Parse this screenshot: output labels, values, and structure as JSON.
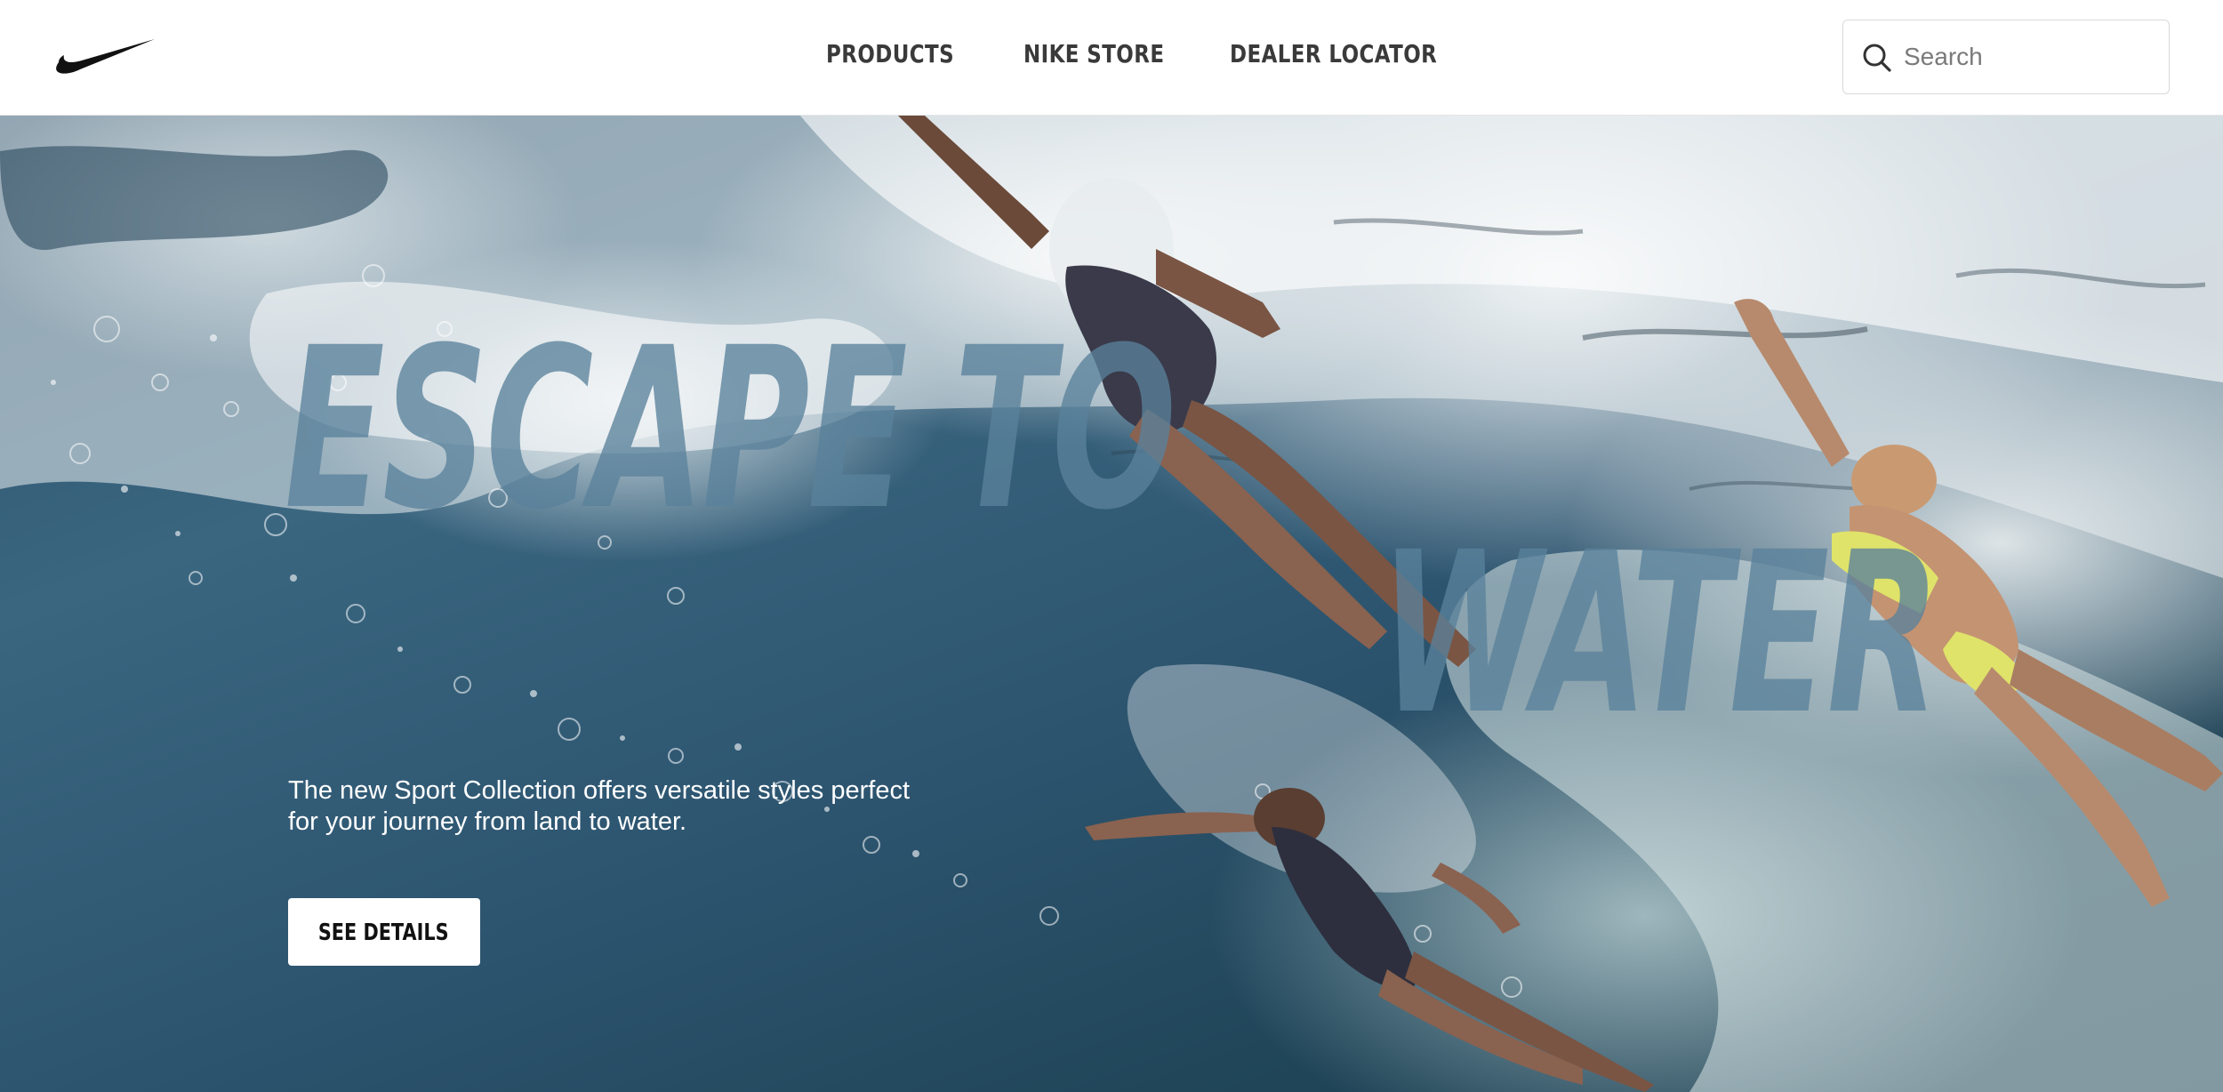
{
  "brand": {
    "logo": "swoosh-logo",
    "logo_color": "#111111"
  },
  "nav": {
    "items": [
      {
        "label": "PRODUCTS"
      },
      {
        "label": "NIKE STORE"
      },
      {
        "label": "DEALER LOCATOR"
      }
    ]
  },
  "search": {
    "placeholder": "Search",
    "icon": "search-icon"
  },
  "hero": {
    "headline_line1": "ESCAPE TO",
    "headline_line2": "WATER",
    "description": "The new Sport Collection offers versatile styles perfect for your journey from land to water.",
    "cta_label": "SEE DETAILS",
    "headline_color": "#5a829b",
    "water_color": "#2d5570"
  }
}
